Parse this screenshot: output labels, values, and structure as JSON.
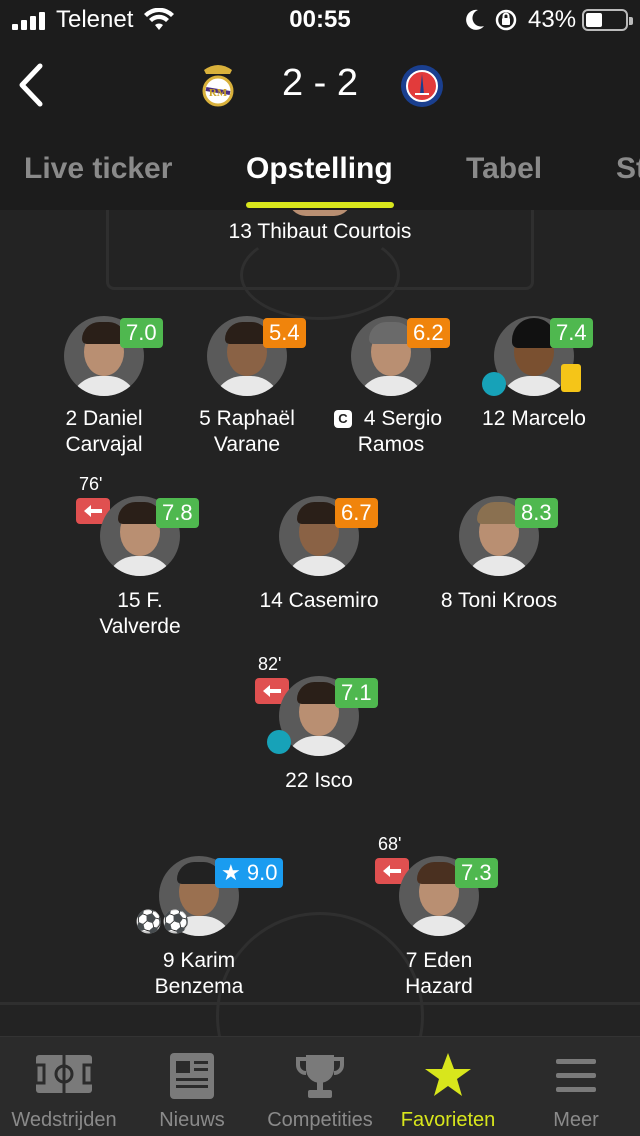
{
  "status_bar": {
    "carrier": "Telenet",
    "time": "00:55",
    "battery": "43%"
  },
  "match": {
    "score": "2 - 2",
    "home_crest": "real-madrid-crest",
    "away_crest": "psg-crest"
  },
  "tabs": [
    {
      "label": "Live ticker",
      "active": false
    },
    {
      "label": "Opstelling",
      "active": true
    },
    {
      "label": "Tabel",
      "active": false
    },
    {
      "label": "St",
      "active": false
    }
  ],
  "goalkeeper": {
    "name": "13 Thibaut Courtois"
  },
  "defenders": [
    {
      "name_line1": "2 Daniel",
      "name_line2": "Carvajal",
      "rating": "7.0",
      "rating_color": "#4fb84f"
    },
    {
      "name_line1": "5 Raphaël",
      "name_line2": "Varane",
      "rating": "5.4",
      "rating_color": "#f0840c"
    },
    {
      "name_line1": "4 Sergio",
      "name_line2": "Ramos",
      "rating": "6.2",
      "rating_color": "#f0840c",
      "captain_badge": "C"
    },
    {
      "name_line1": "12 Marcelo",
      "name_line2": "",
      "rating": "7.4",
      "rating_color": "#4fb84f",
      "yellow_card": true,
      "assist": true
    }
  ],
  "midfielders": [
    {
      "name_line1": "15 F.",
      "name_line2": "Valverde",
      "rating": "7.8",
      "rating_color": "#4fb84f",
      "sub_minute": "76'"
    },
    {
      "name_line1": "14 Casemiro",
      "name_line2": "",
      "rating": "6.7",
      "rating_color": "#f0840c"
    },
    {
      "name_line1": "8 Toni Kroos",
      "name_line2": "",
      "rating": "8.3",
      "rating_color": "#4fb84f"
    }
  ],
  "attacking_mid": {
    "name_line1": "22 Isco",
    "rating": "7.1",
    "rating_color": "#4fb84f",
    "sub_minute": "82'",
    "assist": true
  },
  "forwards": [
    {
      "name_line1": "9 Karim",
      "name_line2": "Benzema",
      "rating": "9.0",
      "rating_color": "#1a9cf0",
      "star": true,
      "goals": 2
    },
    {
      "name_line1": "7 Eden",
      "name_line2": "Hazard",
      "rating": "7.3",
      "rating_color": "#4fb84f",
      "sub_minute": "68'"
    }
  ],
  "bottom_nav": [
    {
      "label": "Wedstrijden",
      "icon": "pitch-icon",
      "active": false
    },
    {
      "label": "Nieuws",
      "icon": "newspaper-icon",
      "active": false
    },
    {
      "label": "Competities",
      "icon": "trophy-icon",
      "active": false
    },
    {
      "label": "Favorieten",
      "icon": "star-icon",
      "active": true
    },
    {
      "label": "Meer",
      "icon": "menu-icon",
      "active": false
    }
  ],
  "colors": {
    "accent": "#d8e61c",
    "background": "#1c1c1c"
  }
}
